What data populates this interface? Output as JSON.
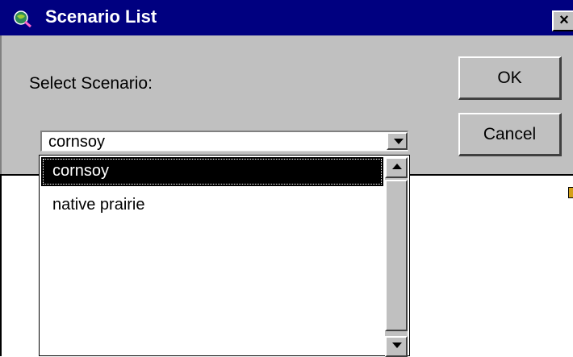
{
  "window": {
    "title": "Scenario List",
    "close_label": "×"
  },
  "form": {
    "label": "Select Scenario:",
    "ok_label": "OK",
    "cancel_label": "Cancel"
  },
  "combo": {
    "selected_value": "cornsoy",
    "options": [
      {
        "label": "cornsoy",
        "selected": true
      },
      {
        "label": "native prairie",
        "selected": false
      }
    ]
  },
  "colors": {
    "titlebar": "#000080",
    "dialog_face": "#c0c0c0",
    "selection": "#000000"
  }
}
